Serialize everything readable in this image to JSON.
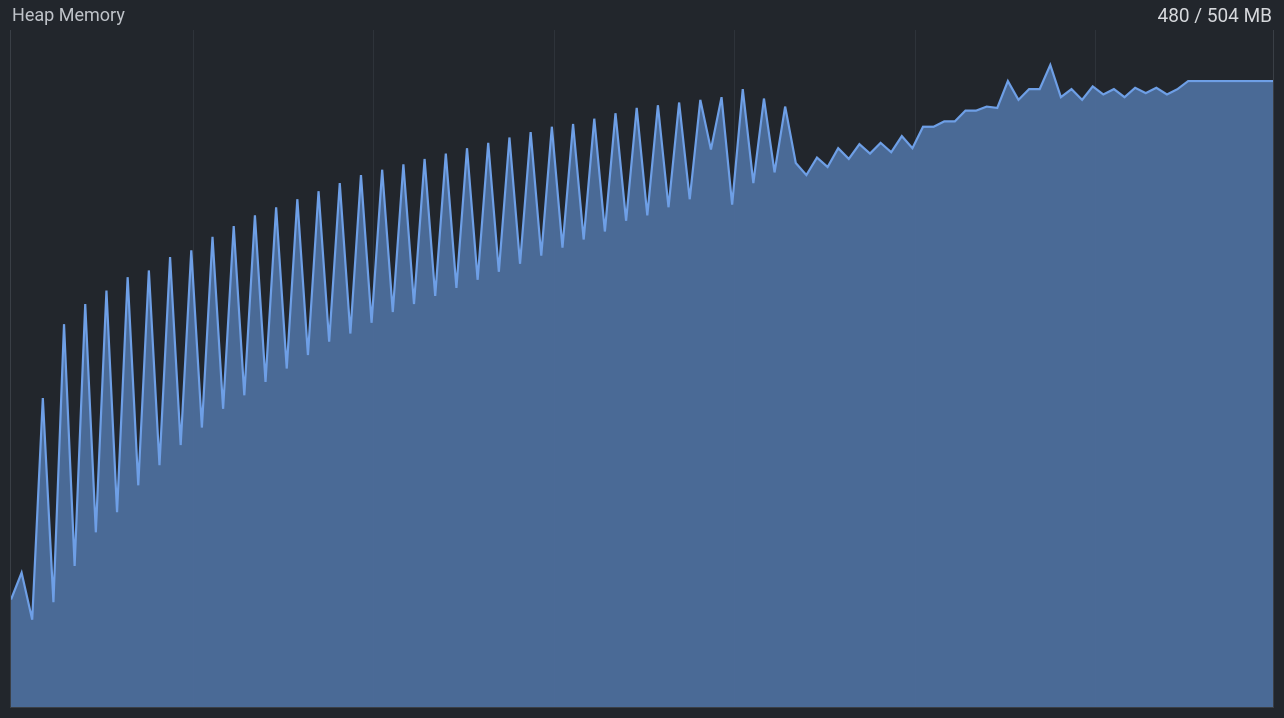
{
  "header": {
    "title": "Heap Memory",
    "memory_status": "480 / 504 MB"
  },
  "chart_data": {
    "type": "area",
    "title": "Heap Memory",
    "xlabel": "",
    "ylabel": "",
    "ylim": [
      0,
      504
    ],
    "grid_x_fractions": [
      0.0,
      0.144,
      0.287,
      0.43,
      0.573,
      0.716,
      0.859,
      1.0
    ],
    "values": [
      80,
      100,
      65,
      230,
      78,
      285,
      105,
      300,
      130,
      310,
      145,
      320,
      165,
      325,
      180,
      335,
      195,
      340,
      208,
      350,
      222,
      358,
      232,
      366,
      242,
      372,
      252,
      378,
      262,
      384,
      272,
      390,
      278,
      396,
      286,
      400,
      294,
      404,
      300,
      408,
      306,
      412,
      312,
      416,
      318,
      420,
      324,
      424,
      330,
      428,
      336,
      432,
      342,
      434,
      348,
      438,
      354,
      442,
      362,
      446,
      366,
      448,
      372,
      450,
      378,
      452,
      415,
      454,
      374,
      460,
      390,
      453,
      398,
      447,
      405,
      396,
      409,
      402,
      416,
      408,
      419,
      412,
      420,
      413,
      425,
      416,
      432,
      432,
      436,
      436,
      444,
      444,
      447,
      446,
      466,
      452,
      460,
      460,
      478,
      454,
      460,
      452,
      462,
      456,
      460,
      454,
      461,
      457,
      461,
      456,
      460,
      466,
      466,
      466,
      466,
      466,
      466,
      466,
      466,
      466
    ],
    "colors": {
      "line": "#6e9fe6",
      "fill": "#4d6e9c",
      "background": "#22262c",
      "grid": "#2e333a"
    }
  }
}
